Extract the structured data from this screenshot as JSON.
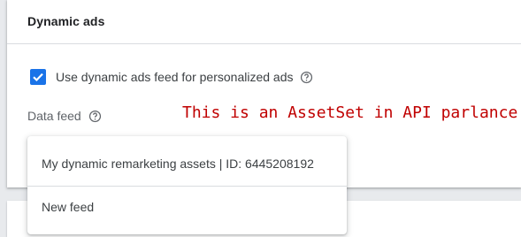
{
  "card": {
    "title": "Dynamic ads"
  },
  "checkbox": {
    "checked": true,
    "label": "Use dynamic ads feed for personalized ads",
    "help_icon": "help-circle-icon"
  },
  "data_feed": {
    "label": "Data feed",
    "help_icon": "help-circle-icon"
  },
  "annotation": {
    "text": "This is an AssetSet in API parlance",
    "color": "#c00000"
  },
  "dropdown_menu": {
    "items": [
      {
        "label": "My dynamic remarketing assets | ID: 6445208192"
      },
      {
        "label": "New feed"
      }
    ]
  },
  "colors": {
    "accent": "#1a73e8",
    "text": "#3c4043",
    "divider": "#dadce0"
  }
}
